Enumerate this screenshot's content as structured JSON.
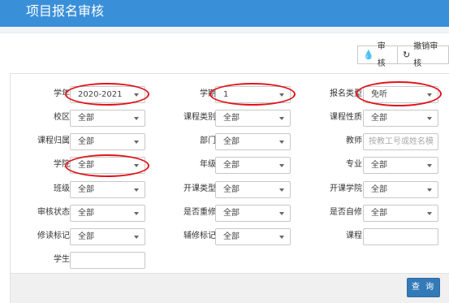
{
  "header": {
    "title": "项目报名审核"
  },
  "toolbar": {
    "audit_label": "审核",
    "undo_label": "撤销审核"
  },
  "form": {
    "rows": [
      [
        {
          "label": "学年",
          "value": "2020-2021"
        },
        {
          "label": "学期",
          "value": "1"
        },
        {
          "label": "报名类型",
          "value": "免听"
        }
      ],
      [
        {
          "label": "校区",
          "value": "全部"
        },
        {
          "label": "课程类别",
          "value": "全部"
        },
        {
          "label": "课程性质",
          "value": "全部"
        }
      ],
      [
        {
          "label": "课程归属",
          "value": "全部"
        },
        {
          "label": "部门",
          "value": "全部"
        },
        {
          "label": "教师",
          "placeholder": "按教工号或姓名模"
        }
      ],
      [
        {
          "label": "学院",
          "value": "全部"
        },
        {
          "label": "年级",
          "value": "全部"
        },
        {
          "label": "专业",
          "value": "全部"
        }
      ],
      [
        {
          "label": "班级",
          "value": "全部"
        },
        {
          "label": "开课类型",
          "value": "全部"
        },
        {
          "label": "开课学院",
          "value": "全部"
        }
      ],
      [
        {
          "label": "审核状态",
          "value": "全部"
        },
        {
          "label": "是否重修",
          "value": "全部"
        },
        {
          "label": "是否自修",
          "value": "全部"
        }
      ],
      [
        {
          "label": "修读标记",
          "value": "全部"
        },
        {
          "label": "辅修标记",
          "value": "全部"
        },
        {
          "label": "课程",
          "value": ""
        }
      ],
      [
        {
          "label": "学生",
          "value": ""
        }
      ]
    ]
  },
  "footer": {
    "query_label": "查 询"
  },
  "annotation_color": "#e0141b"
}
